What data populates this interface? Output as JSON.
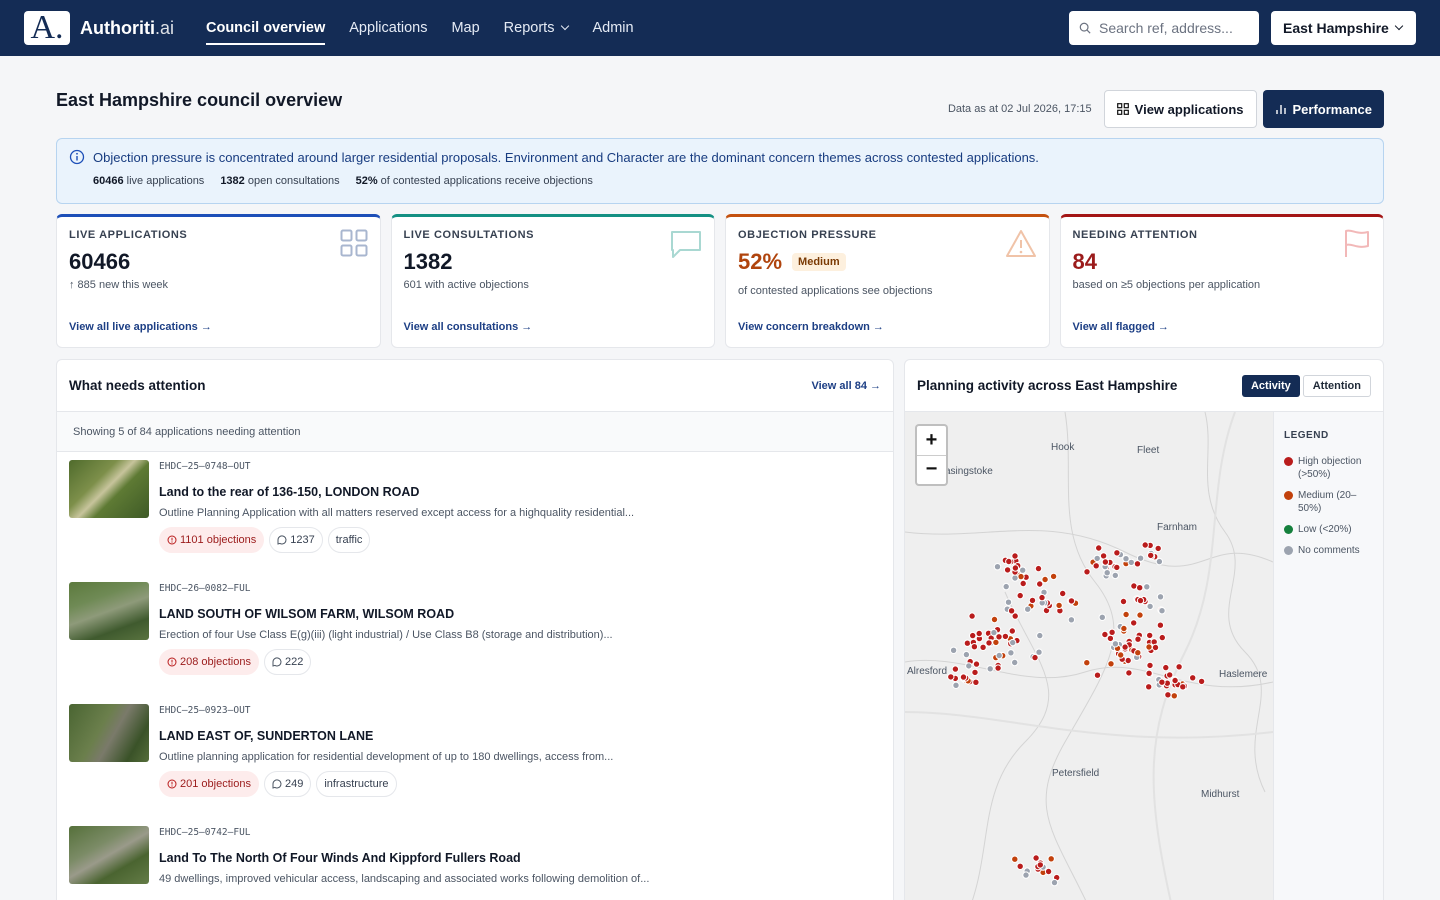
{
  "nav": {
    "brand": "Authoriti",
    "brand_suffix": ".ai",
    "links": [
      {
        "label": "Council overview",
        "active": true
      },
      {
        "label": "Applications"
      },
      {
        "label": "Map"
      },
      {
        "label": "Reports",
        "dropdown": true
      },
      {
        "label": "Admin"
      }
    ],
    "search_placeholder": "Search ref, address...",
    "council": "East Hampshire"
  },
  "header": {
    "title": "East Hampshire council overview",
    "as_of": "Data as at 02 Jul 2026, 17:15",
    "view_applications": "View applications",
    "performance": "Performance"
  },
  "banner": {
    "message": "Objection pressure is concentrated around larger residential proposals. Environment and Character are the dominant concern themes across contested applications.",
    "stats": [
      {
        "value": "60466",
        "label": " live applications"
      },
      {
        "value": "1382",
        "label": " open consultations"
      },
      {
        "value": "52%",
        "label": " of contested applications receive objections"
      }
    ]
  },
  "kpis": [
    {
      "label": "LIVE APPLICATIONS",
      "value": "60466",
      "sub": "↑ 885 new this week",
      "link": "View all live applications →",
      "icon": "grid-icon"
    },
    {
      "label": "LIVE CONSULTATIONS",
      "value": "1382",
      "sub": "601 with active objections",
      "link": "View all consultations →",
      "icon": "chat-icon"
    },
    {
      "label": "OBJECTION PRESSURE",
      "value": "52%",
      "badge": "Medium",
      "sub": "of contested applications see objections",
      "link": "View concern breakdown →",
      "icon": "warning-icon"
    },
    {
      "label": "NEEDING ATTENTION",
      "value": "84",
      "sub": "based on ≥5 objections per application",
      "link": "View all flagged →",
      "icon": "flag-icon"
    }
  ],
  "attention": {
    "title": "What needs attention",
    "view_all": "View all 84 →",
    "showing": "Showing 5 of 84 applications needing attention",
    "items": [
      {
        "ref": "EHDC–25–0748–OUT",
        "title": "Land to the rear of 136-150, LONDON ROAD",
        "desc": "Outline Planning Application with all matters reserved except access for a highquality residential...",
        "objections": "1101 objections",
        "comments": "1237",
        "tag": "traffic"
      },
      {
        "ref": "EHDC–26–0082–FUL",
        "title": "LAND SOUTH OF WILSOM FARM, WILSOM ROAD",
        "desc": "Erection of four Use Class E(g)(iii) (light industrial) / Use Class B8 (storage and distribution)...",
        "objections": "208 objections",
        "comments": "222",
        "tag": ""
      },
      {
        "ref": "EHDC–25–0923–OUT",
        "title": "LAND EAST OF, SUNDERTON LANE",
        "desc": "Outline planning application for residential development of up to 180 dwellings, access from...",
        "objections": "201 objections",
        "comments": "249",
        "tag": "infrastructure"
      },
      {
        "ref": "EHDC–25–0742–FUL",
        "title": "Land To The North Of  Four Winds And Kippford Fullers Road",
        "desc": "49 dwellings, improved vehicular access, landscaping and associated works following demolition of...",
        "objections": "",
        "comments": "",
        "tag": ""
      }
    ]
  },
  "map": {
    "title": "Planning activity across East Hampshire",
    "tabs": [
      "Activity",
      "Attention"
    ],
    "zoom_in": "+",
    "zoom_out": "−",
    "places": [
      "Hook",
      "Fleet",
      "asingstoke",
      "Farnham",
      "Alresford",
      "Haslemere",
      "Petersfield",
      "Midhurst"
    ],
    "legend_title": "LEGEND",
    "legend": [
      {
        "label": "High objection (>50%)",
        "color": "#b91c1c"
      },
      {
        "label": "Medium (20–50%)",
        "color": "#c2410c"
      },
      {
        "label": "Low (<20%)",
        "color": "#15803d"
      },
      {
        "label": "No comments",
        "color": "#9ca3af"
      }
    ]
  }
}
